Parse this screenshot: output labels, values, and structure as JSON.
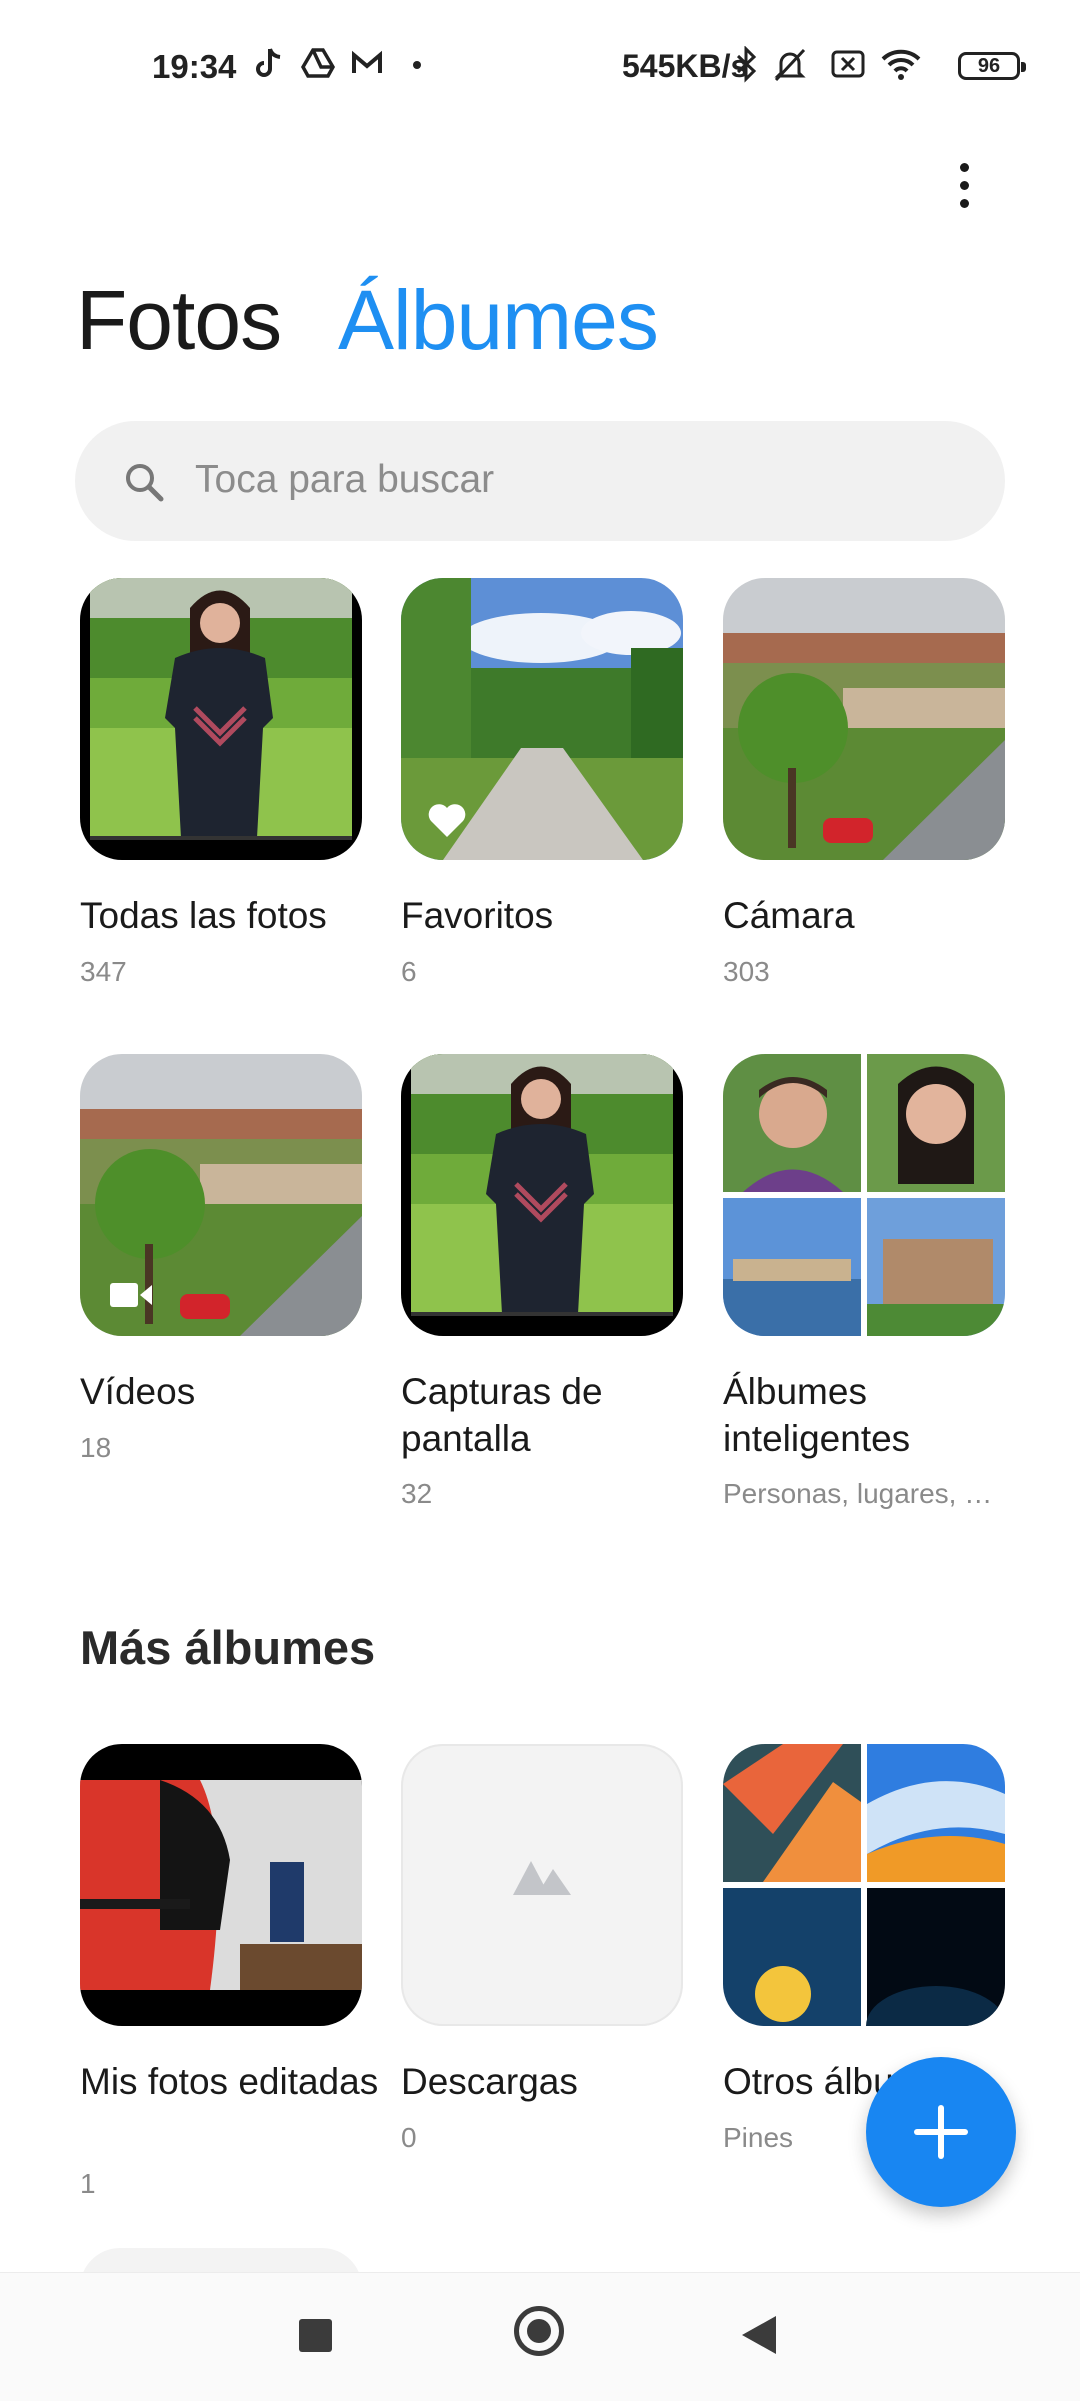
{
  "status_bar": {
    "time": "19:34",
    "network_speed": "545KB/s",
    "battery_level": "96",
    "icons": [
      "tiktok-icon",
      "drive-icon",
      "gmail-icon",
      "notification-dot-icon",
      "bluetooth-icon",
      "mute-icon",
      "sim-off-icon",
      "wifi-icon",
      "battery-icon"
    ]
  },
  "header": {
    "more_menu_icon": "more-vertical-icon",
    "tabs": [
      {
        "label": "Fotos",
        "active": false
      },
      {
        "label": "Álbumes",
        "active": true
      }
    ]
  },
  "search": {
    "icon": "search-icon",
    "placeholder": "Toca para buscar"
  },
  "albums": [
    {
      "name": "Todas las fotos",
      "count": "347"
    },
    {
      "name": "Favoritos",
      "count": "6",
      "badge_icon": "heart-icon"
    },
    {
      "name": "Cámara",
      "count": "303"
    },
    {
      "name": "Vídeos",
      "count": "18",
      "badge_icon": "video-camera-icon"
    },
    {
      "name": "Capturas de pantalla",
      "count": "32"
    },
    {
      "name": "Álbumes inteligentes",
      "count": "Personas, lugares, …"
    }
  ],
  "more_albums": {
    "title": "Más álbumes",
    "albums": [
      {
        "name": "Mis fotos editadas",
        "count": "1"
      },
      {
        "name": "Descargas",
        "count": "0",
        "placeholder_icon": "mountains-icon"
      },
      {
        "name": "Otros álbumes",
        "count": "Pines"
      }
    ]
  },
  "fab": {
    "icon": "plus-icon"
  },
  "navigation_bar": {
    "icons": [
      "recent-apps-icon",
      "home-icon",
      "back-icon"
    ]
  },
  "colors": {
    "accent": "#1e8ff2",
    "fab": "#1886f2",
    "search_background": "#f1f1f1",
    "secondary_text": "#8a8a8a"
  }
}
